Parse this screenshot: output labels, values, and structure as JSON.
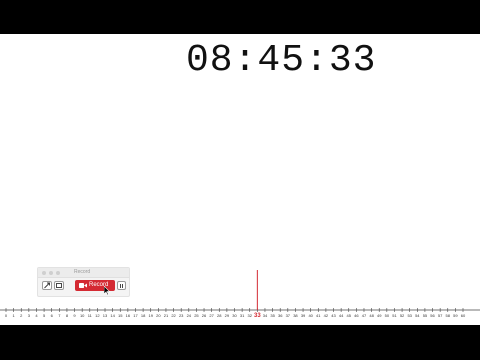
{
  "clock": {
    "time": "08:45:33"
  },
  "recorder": {
    "title": "Record",
    "record_label": "Record",
    "tools": [
      "arrow-tool-icon",
      "rectangle-tool-icon"
    ],
    "record_icon": "video-camera-icon",
    "pause_icon": "pause-icon",
    "accent_color": "#d42a33"
  },
  "timeline": {
    "min": 0,
    "max": 60,
    "current": 33,
    "marker_color": "#d42a33"
  }
}
